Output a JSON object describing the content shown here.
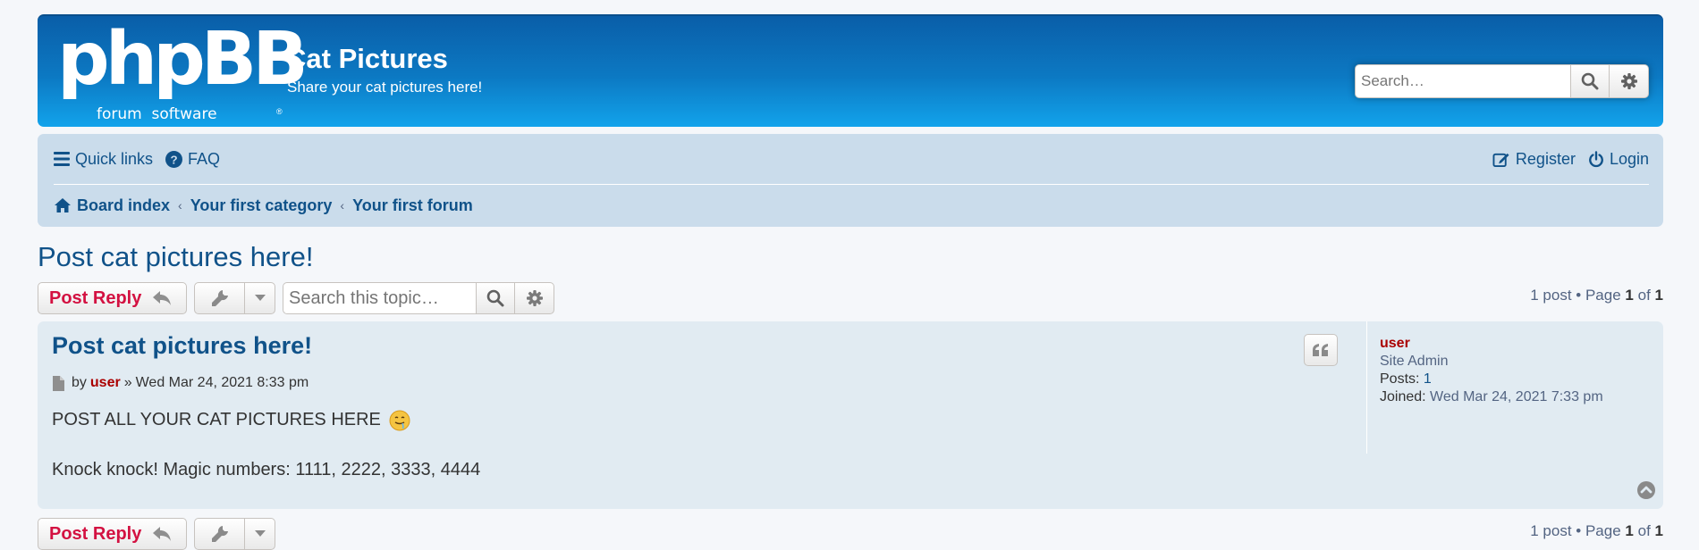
{
  "header": {
    "logo_text": "phpBB",
    "logo_subtext": "forum  software",
    "logo_reg": "®",
    "title": "Cat Pictures",
    "description": "Share your cat pictures here!",
    "search_placeholder": "Search…"
  },
  "navbar": {
    "quick_links": "Quick links",
    "faq": "FAQ",
    "register": "Register",
    "login": "Login",
    "breadcrumbs": [
      "Board index",
      "Your first category",
      "Your first forum"
    ],
    "separator": "‹"
  },
  "topic": {
    "title": "Post cat pictures here!",
    "post_reply": "Post Reply",
    "search_placeholder": "Search this topic…",
    "pagination": {
      "count": "1 post",
      "bullet": "•",
      "page_word": "Page",
      "current": "1",
      "of": "of",
      "total": "1"
    }
  },
  "post": {
    "subject": "Post cat pictures here!",
    "by": "by",
    "author": "user",
    "date_sep": "»",
    "date": "Wed Mar 24, 2021 8:33 pm",
    "body_line1": "POST ALL YOUR CAT PICTURES HERE",
    "body_line2": "Knock knock! Magic numbers: 1111, 2222, 3333, 4444",
    "profile": {
      "username": "user",
      "rank": "Site Admin",
      "posts_label": "Posts:",
      "posts_value": "1",
      "joined_label": "Joined:",
      "joined_value": "Wed Mar 24, 2021 7:33 pm"
    }
  },
  "colors": {
    "link": "#105289",
    "reply_red": "#d31141",
    "author_red": "#aa0000",
    "navbar_bg": "#cadceb",
    "post_bg": "#e1ebf2"
  }
}
